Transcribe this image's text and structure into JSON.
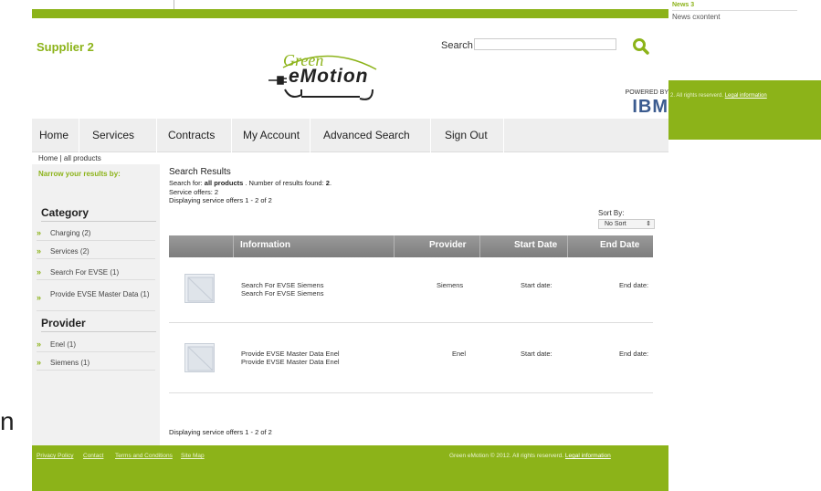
{
  "background": {
    "news_title": "News 3",
    "news_content": "News cxontent",
    "footer_fragment": "2. All rights reserverd.",
    "footer_fragment_link": "Legal information",
    "letter": "n"
  },
  "header": {
    "supplier": "Supplier 2",
    "logo_line1": "Green",
    "logo_line2": "eMotion",
    "search_label": "Search",
    "search_value": "",
    "powered_by": "POWERED BY",
    "ibm": "IBM"
  },
  "nav": {
    "items": [
      "Home",
      "Services",
      "Contracts",
      "My Account",
      "Advanced Search",
      "Sign Out"
    ]
  },
  "breadcrumb": "Home | all products",
  "sidebar": {
    "narrow_label": "Narrow your results by:",
    "category_heading": "Category",
    "categories": [
      "Charging (2)",
      "Services (2)",
      "Search For EVSE (1)",
      "Provide EVSE Master Data (1)"
    ],
    "provider_heading": "Provider",
    "providers": [
      "Enel (1)",
      "Siemens (1)"
    ]
  },
  "results": {
    "title": "Search Results",
    "search_for_prefix": "Search for: ",
    "search_for_term": "all products",
    "found_text": " . Number of results found: ",
    "found_count": "2",
    "found_suffix": ".",
    "service_offers": "Service offers: 2",
    "displaying": "Displaying service offers 1 - 2 of 2",
    "sort_by_label": "Sort By:",
    "sort_value": "No Sort",
    "columns": [
      "Information",
      "Provider",
      "Start Date",
      "End Date"
    ],
    "rows": [
      {
        "info_line1": "Search For EVSE Siemens",
        "info_line2": "Search For EVSE Siemens",
        "provider": "Siemens",
        "start": "Start date:",
        "end": "End date:"
      },
      {
        "info_line1": "Provide EVSE Master Data Enel",
        "info_line2": "Provide EVSE Master Data Enel",
        "provider": "Enel",
        "start": "Start date:",
        "end": "End date:"
      }
    ],
    "displaying_bottom": "Displaying service offers 1 - 2 of 2"
  },
  "footer": {
    "links": [
      "Privacy Policy",
      "Contact",
      "Terms and Conditions",
      "Site Map"
    ],
    "copyright": "Green eMotion © 2012. All rights reserverd.",
    "legal": "Legal information"
  },
  "colors": {
    "accent": "#8cb319",
    "table_header": "#8a8a8a",
    "sidebar_bg": "#f1f1f1",
    "nav_bg": "#eeeeee"
  }
}
